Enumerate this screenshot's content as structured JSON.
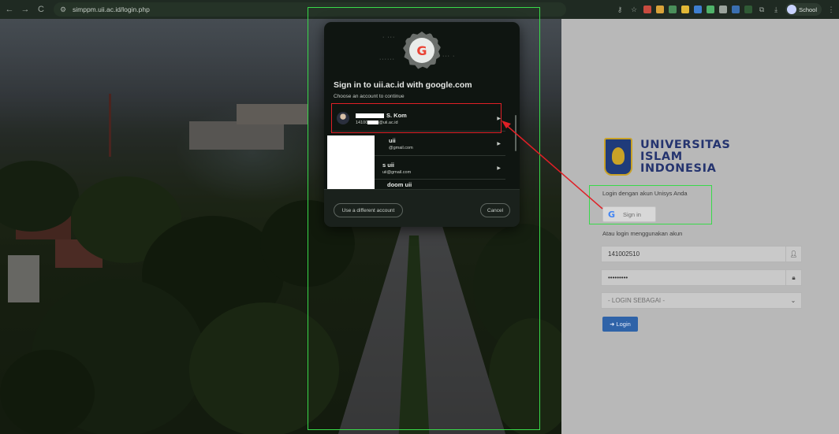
{
  "browser": {
    "url": "simppm.uii.ac.id/login.php",
    "profile_label": "School",
    "nav_back": "←",
    "nav_forward": "→",
    "nav_reload": "C"
  },
  "google_chooser": {
    "title": "Sign in to uii.ac.id with google.com",
    "subtitle": "Choose an account to continue",
    "accounts": [
      {
        "name_suffix": "S. Kom",
        "email_prefix": "14100",
        "email_suffix": "@uii.ac.id"
      },
      {
        "name_suffix": "uii",
        "email_suffix": "@gmail.com"
      },
      {
        "name_suffix": "s uii",
        "email_suffix": "uii@gmail.com"
      },
      {
        "name_suffix": "doom uii"
      }
    ],
    "use_different_label": "Use a different account",
    "cancel_label": "Cancel"
  },
  "login_page": {
    "university_lines": [
      "UNIVERSITAS",
      "ISLAM",
      "INDONESIA"
    ],
    "unisys_label": "Login dengan akun Unisys Anda",
    "google_signin_label": "Sign in",
    "alt_login_label": "Atau login menggunakan akun",
    "username_value": "141002510",
    "password_value": "•••••••••",
    "role_placeholder": "- LOGIN SEBAGAI -",
    "login_button_label": "Login"
  },
  "colors": {
    "annotation_green": "#39d94a",
    "annotation_red": "#e01f26",
    "login_button": "#2f63a8",
    "uii_blue": "#25346f"
  }
}
